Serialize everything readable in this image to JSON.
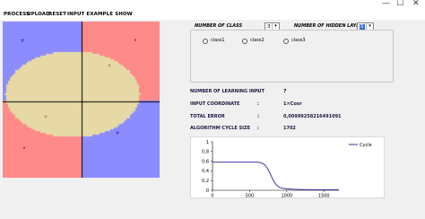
{
  "window": {
    "controls": {
      "minimize": "—",
      "maximize": "☐",
      "close": "✕"
    }
  },
  "menu": {
    "items": [
      "PROCESS",
      "UPLOAD",
      "RESET",
      "INPUT EXAMPLE SHOW"
    ]
  },
  "plane": {
    "colors": {
      "class_red": "#ff8a8a",
      "class_blue": "#8c8cff",
      "class_tan": "#e6d9a6"
    },
    "markers": {
      "red": "•",
      "blue": "+",
      "tan": "+"
    }
  },
  "controls": {
    "number_of_class_label": "NUMBER OF CLASS",
    "number_of_class_value": "3",
    "number_of_hidden_layer_label": "NUMBER OF HIDDEN LAYER",
    "number_of_hidden_layer_value": "5",
    "classes": [
      "class1",
      "class2",
      "class3"
    ]
  },
  "stats": {
    "rows": [
      {
        "label": "NUMBER OF LEARNING INPUT",
        "sep": ":",
        "value": "7"
      },
      {
        "label": "INPUT COORDINATE",
        "sep": ":",
        "value": "1×Coor"
      },
      {
        "label": "TOTAL ERROR",
        "sep": ":",
        "value": "0,00999258216491091"
      },
      {
        "label": "ALGORITHM CYCLE SIZE",
        "sep": ":",
        "value": "1702"
      }
    ]
  },
  "chart_data": {
    "type": "line",
    "title": "",
    "xlabel": "",
    "ylabel": "",
    "xlim": [
      0,
      1702
    ],
    "ylim": [
      0,
      1
    ],
    "xticks": [
      0,
      500,
      1000,
      1500
    ],
    "yticks": [
      0,
      0.2,
      0.4,
      0.6,
      0.8,
      1
    ],
    "xtick_labels": [
      "0",
      "500",
      "1000",
      "1500"
    ],
    "ytick_labels": [
      "0",
      "0,2",
      "0,4",
      "0,6",
      "0,8",
      "1"
    ],
    "legend": "top-right",
    "color": "#1f1f8f",
    "series": [
      {
        "name": "Cycle",
        "x": [
          0,
          100,
          200,
          300,
          400,
          500,
          600,
          650,
          700,
          740,
          780,
          820,
          860,
          900,
          950,
          1000,
          1100,
          1200,
          1300,
          1400,
          1500,
          1600,
          1702
        ],
        "y": [
          0.58,
          0.58,
          0.58,
          0.58,
          0.58,
          0.58,
          0.58,
          0.57,
          0.53,
          0.45,
          0.33,
          0.2,
          0.11,
          0.06,
          0.04,
          0.03,
          0.02,
          0.015,
          0.012,
          0.011,
          0.01,
          0.01,
          0.01
        ]
      }
    ]
  }
}
